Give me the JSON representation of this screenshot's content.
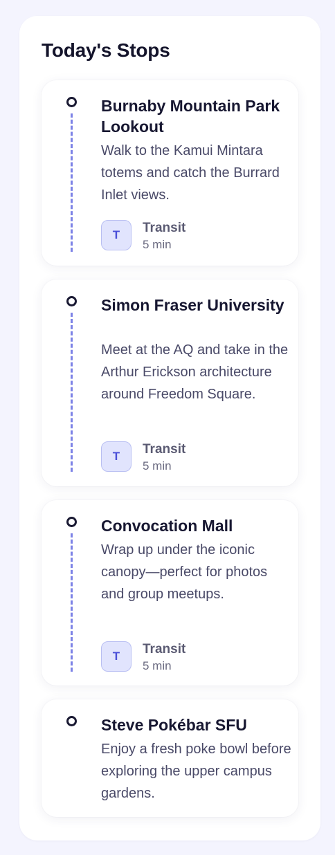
{
  "title": "Today's Stops",
  "colors": {
    "background": "#f4f4fe",
    "card": "#ffffff",
    "accent": "#7c82e6",
    "badge": "#e1e4fd",
    "heading": "#14142b"
  },
  "stops": [
    {
      "name": "Burnaby Mountain Park Lookout",
      "description": "Walk to the Kamui Mintara totems and catch the Burrard Inlet views.",
      "transit": {
        "icon": "T",
        "mode": "Transit",
        "duration": "5 min"
      }
    },
    {
      "name": "Simon Fraser University",
      "description": "Meet at the AQ and take in the Arthur Erickson architecture around Freedom Square.",
      "transit": {
        "icon": "T",
        "mode": "Transit",
        "duration": "5 min"
      }
    },
    {
      "name": "Convocation Mall",
      "description": "Wrap up under the iconic canopy—perfect for photos and group meetups.",
      "transit": {
        "icon": "T",
        "mode": "Transit",
        "duration": "5 min"
      }
    },
    {
      "name": "Steve Pokébar SFU",
      "description": "Enjoy a fresh poke bowl before exploring the upper campus gardens."
    }
  ]
}
